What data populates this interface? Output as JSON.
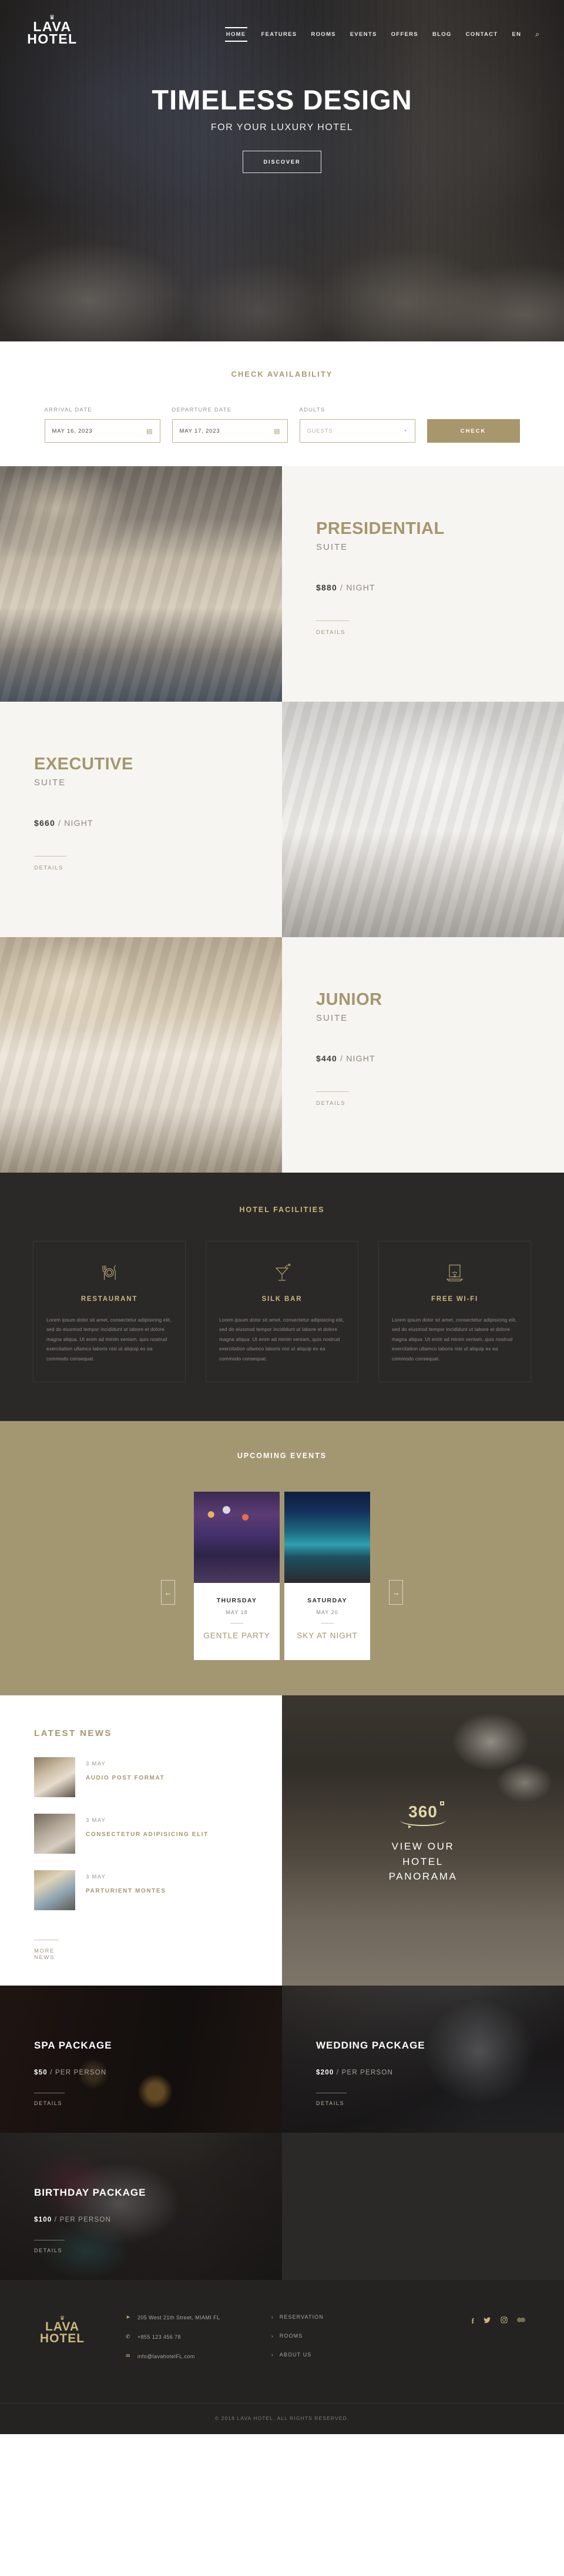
{
  "header": {
    "logo": {
      "crown": "♛",
      "line1": "LAVA",
      "line2": "HOTEL"
    },
    "nav": [
      {
        "label": "HOME",
        "active": true
      },
      {
        "label": "FEATURES",
        "active": false
      },
      {
        "label": "ROOMS",
        "active": false
      },
      {
        "label": "EVENTS",
        "active": false
      },
      {
        "label": "OFFERS",
        "active": false
      },
      {
        "label": "BLOG",
        "active": false
      },
      {
        "label": "CONTACT",
        "active": false
      },
      {
        "label": "EN",
        "active": false
      }
    ],
    "search_icon": "⌕"
  },
  "hero": {
    "title": "TIMELESS DESIGN",
    "subtitle": "FOR YOUR LUXURY HOTEL",
    "button": "DISCOVER"
  },
  "availability": {
    "title": "CHECK AVAILABILITY",
    "arrival": {
      "label": "ARRIVAL DATE",
      "value": "MAY 16, 2023",
      "icon": "calendar-icon"
    },
    "departure": {
      "label": "DEPARTURE DATE",
      "value": "MAY 17, 2023",
      "icon": "calendar-icon"
    },
    "adults": {
      "label": "ADULTS",
      "placeholder": "GUESTS",
      "value": "GUESTS"
    },
    "check_button": "CHECK"
  },
  "suites": [
    {
      "name": "PRESIDENTIAL",
      "sub": "SUITE",
      "price": "$880",
      "per": "/ NIGHT",
      "details": "DETAILS",
      "image_side": "left"
    },
    {
      "name": "EXECUTIVE",
      "sub": "SUITE",
      "price": "$660",
      "per": "/ NIGHT",
      "details": "DETAILS",
      "image_side": "right"
    },
    {
      "name": "JUNIOR",
      "sub": "SUITE",
      "price": "$440",
      "per": "/ NIGHT",
      "details": "DETAILS",
      "image_side": "left"
    }
  ],
  "facilities": {
    "title": "HOTEL FACILITIES",
    "items": [
      {
        "icon": "restaurant-icon",
        "name": "RESTAURANT",
        "text": "Lorem ipsum dolor sit amet, consectetur adipisicing elit, sed do eiusmod tempor incididunt ut labore et dolore magna aliqua. Ut enim ad minim veniam, quis nostrud exercitation ullamco laboris nisi ut aliquip ex ea commodo consequat."
      },
      {
        "icon": "cocktail-icon",
        "name": "SILK BAR",
        "text": "Lorem ipsum dolor sit amet, consectetur adipisicing elit, sed do eiusmod tempor incididunt ut labore et dolore magna aliqua. Ut enim ad minim veniam, quis nostrud exercitation ullamco laboris nisi ut aliquip ex ea commodo consequat."
      },
      {
        "icon": "wifi-icon",
        "name": "FREE WI-FI",
        "text": "Lorem ipsum dolor sit amet, consectetur adipisicing elit, sed do eiusmod tempor incididunt ut labore et dolore magna aliqua. Ut enim ad minim veniam, quis nostrud exercitation ullamco laboris nisi ut aliquip ex ea commodo consequat."
      }
    ]
  },
  "events": {
    "title": "UPCOMING EVENTS",
    "prev_icon": "←",
    "next_icon": "→",
    "items": [
      {
        "day": "THURSDAY",
        "date": "MAY 18",
        "name": "GENTLE PARTY"
      },
      {
        "day": "SATURDAY",
        "date": "MAY 20",
        "name": "SKY AT NIGHT"
      }
    ]
  },
  "news": {
    "title": "LATEST NEWS",
    "items": [
      {
        "date": "3 MAY",
        "title": "AUDIO POST FORMAT"
      },
      {
        "date": "3 MAY",
        "title": "CONSECTETUR ADIPISICING ELIT"
      },
      {
        "date": "3 MAY",
        "title": "PARTURIENT MONTES"
      }
    ],
    "more": "MORE NEWS"
  },
  "panorama": {
    "badge": "360",
    "line1": "VIEW OUR",
    "line2": "HOTEL",
    "line3": "PANORAMA"
  },
  "packages": [
    {
      "name": "SPA PACKAGE",
      "price": "$50",
      "per": "/ PER PERSON",
      "details": "DETAILS"
    },
    {
      "name": "WEDDING PACKAGE",
      "price": "$200",
      "per": "/ PER PERSON",
      "details": "DETAILS"
    },
    {
      "name": "BIRTHDAY PACKAGE",
      "price": "$100",
      "per": "/ PER PERSON",
      "details": "DETAILS"
    }
  ],
  "footer": {
    "logo": {
      "crown": "♛",
      "line1": "LAVA",
      "line2": "HOTEL"
    },
    "contact": [
      {
        "icon": "location-icon",
        "text": "205 West 21th Street, MIAMI FL"
      },
      {
        "icon": "phone-icon",
        "text": "+855 123 456 78"
      },
      {
        "icon": "mail-icon",
        "text": "info@lavahotelFL.com"
      }
    ],
    "links": [
      {
        "chevron": "›",
        "label": "RESERVATION"
      },
      {
        "chevron": "›",
        "label": "ROOMS"
      },
      {
        "chevron": "›",
        "label": "ABOUT US"
      }
    ],
    "social": [
      {
        "icon": "facebook-icon",
        "glyph": "f"
      },
      {
        "icon": "twitter-icon",
        "glyph": "🐦"
      },
      {
        "icon": "instagram-icon",
        "glyph": "▣"
      },
      {
        "icon": "tripadvisor-icon",
        "glyph": "◎"
      }
    ],
    "copyright": "© 2018 LAVA HOTEL. ALL RIGHTS RESERVED."
  },
  "colors": {
    "gold": "#a4966e",
    "gold_light": "#cbb87f",
    "dark": "#2b2927",
    "cream": "#f7f5f1",
    "olive": "#a39772"
  }
}
